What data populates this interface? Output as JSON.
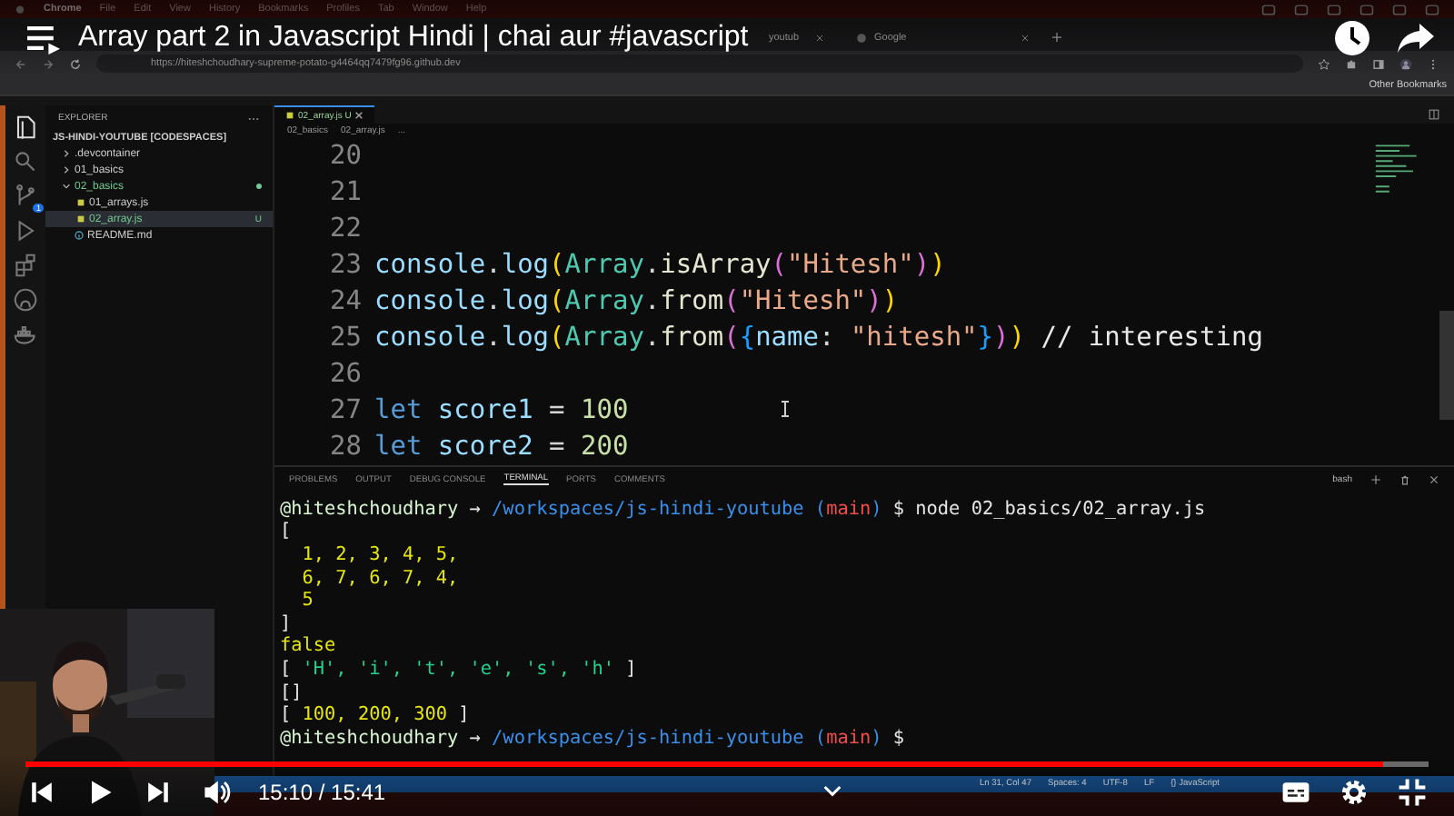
{
  "menu_bar": {
    "items": [
      "Chrome",
      "File",
      "Edit",
      "View",
      "History",
      "Bookmarks",
      "Profiles",
      "Tab",
      "Window",
      "Help"
    ]
  },
  "browser": {
    "tabs": [
      {
        "label": "youtub",
        "selected": false
      },
      {
        "label": "Google",
        "selected": false
      }
    ],
    "url": "https://hiteshchoudhary-supreme-potato-g4464qq7479fg96.github.dev",
    "bookmarks": [
      "Other Bookmarks"
    ]
  },
  "activity_bar": [
    {
      "selected": true
    },
    {
      "selected": false
    },
    {
      "selected": false,
      "badge": "1"
    },
    {
      "selected": false
    },
    {
      "selected": false
    },
    {
      "selected": false
    },
    {
      "selected": false
    }
  ],
  "explorer": {
    "title": "EXPLORER",
    "root": "JS-HINDI-YOUTUBE [CODESPACES]",
    "items": [
      {
        "label": ".devcontainer",
        "kind": "folder",
        "expanded": false,
        "selected": false,
        "untracked": false
      },
      {
        "label": "01_basics",
        "kind": "folder",
        "expanded": false,
        "selected": false,
        "untracked": false
      },
      {
        "label": "02_basics",
        "kind": "folder",
        "expanded": true,
        "selected": false,
        "untracked": true,
        "children": [
          {
            "label": "01_arrays.js",
            "kind": "js",
            "selected": false,
            "untracked": false
          },
          {
            "label": "02_array.js",
            "kind": "js",
            "selected": true,
            "untracked": true,
            "badge": "U"
          }
        ]
      },
      {
        "label": "README.md",
        "kind": "info",
        "selected": false,
        "untracked": false
      }
    ]
  },
  "editor": {
    "tabs": [
      {
        "label": "02_array.js",
        "badge": "U",
        "selected": true
      }
    ],
    "breadcrumb": [
      "02_basics",
      "02_array.js",
      "..."
    ],
    "lines": [
      {
        "number": "20"
      },
      {
        "number": "21"
      },
      {
        "number": "22"
      },
      {
        "number": "23",
        "tokens": [
          {
            "t": "console",
            "kind": "ident"
          },
          {
            "t": ".",
            "kind": "plain"
          },
          {
            "t": "log",
            "kind": "ident"
          },
          {
            "t": "(",
            "kind": "b1"
          },
          {
            "t": "Array",
            "kind": "type"
          },
          {
            "t": ".",
            "kind": "plain"
          },
          {
            "t": "isArray",
            "kind": "func"
          },
          {
            "t": "(",
            "kind": "b2"
          },
          {
            "t": "\"Hitesh\"",
            "kind": "str"
          },
          {
            "t": ")",
            "kind": "b2"
          },
          {
            "t": ")",
            "kind": "b1"
          }
        ]
      },
      {
        "number": "24",
        "tokens": [
          {
            "t": "console",
            "kind": "ident"
          },
          {
            "t": ".",
            "kind": "plain"
          },
          {
            "t": "log",
            "kind": "ident"
          },
          {
            "t": "(",
            "kind": "b1"
          },
          {
            "t": "Array",
            "kind": "type"
          },
          {
            "t": ".",
            "kind": "plain"
          },
          {
            "t": "from",
            "kind": "func"
          },
          {
            "t": "(",
            "kind": "b2"
          },
          {
            "t": "\"Hitesh\"",
            "kind": "str"
          },
          {
            "t": ")",
            "kind": "b2"
          },
          {
            "t": ")",
            "kind": "b1"
          }
        ]
      },
      {
        "number": "25",
        "tokens": [
          {
            "t": "console",
            "kind": "ident"
          },
          {
            "t": ".",
            "kind": "plain"
          },
          {
            "t": "log",
            "kind": "ident"
          },
          {
            "t": "(",
            "kind": "b1"
          },
          {
            "t": "Array",
            "kind": "type"
          },
          {
            "t": ".",
            "kind": "plain"
          },
          {
            "t": "from",
            "kind": "func"
          },
          {
            "t": "(",
            "kind": "b2"
          },
          {
            "t": "{",
            "kind": "b3"
          },
          {
            "t": "name",
            "kind": "ident"
          },
          {
            "t": ": ",
            "kind": "plain"
          },
          {
            "t": "\"hitesh\"",
            "kind": "str"
          },
          {
            "t": "}",
            "kind": "b3"
          },
          {
            "t": ")",
            "kind": "b2"
          },
          {
            "t": ")",
            "kind": "b1"
          },
          {
            "t": " // interesting",
            "kind": "comment"
          }
        ]
      },
      {
        "number": "26"
      },
      {
        "number": "27",
        "tokens": [
          {
            "t": "let",
            "kind": "kw"
          },
          {
            "t": " score1",
            "kind": "ident"
          },
          {
            "t": " = ",
            "kind": "plain"
          },
          {
            "t": "100",
            "kind": "num"
          }
        ]
      },
      {
        "number": "28",
        "tokens": [
          {
            "t": "let",
            "kind": "kw"
          },
          {
            "t": " score2",
            "kind": "ident"
          },
          {
            "t": " = ",
            "kind": "plain"
          },
          {
            "t": "200",
            "kind": "num"
          }
        ]
      }
    ]
  },
  "panel": {
    "tabs": [
      {
        "label": "PROBLEMS",
        "selected": false
      },
      {
        "label": "OUTPUT",
        "selected": false
      },
      {
        "label": "DEBUG CONSOLE",
        "selected": false
      },
      {
        "label": "TERMINAL",
        "selected": true
      },
      {
        "label": "PORTS",
        "selected": false
      },
      {
        "label": "COMMENTS",
        "selected": false
      }
    ],
    "shell": "bash",
    "terminal": [
      [
        {
          "t": "@hiteshchoudhary",
          "kind": "user"
        },
        {
          "t": " → ",
          "kind": "plain"
        },
        {
          "t": "/workspaces/js-hindi-youtube (",
          "kind": "path"
        },
        {
          "t": "main",
          "kind": "branch"
        },
        {
          "t": ")",
          "kind": "path"
        },
        {
          "t": " $ node 02_basics/02_array.js",
          "kind": "plain"
        }
      ],
      [
        {
          "t": "[",
          "kind": "plain"
        }
      ],
      [
        {
          "t": "  1, 2, 3, 4, 5,",
          "kind": "num"
        }
      ],
      [
        {
          "t": "  6, 7, 6, 7, 4,",
          "kind": "num"
        }
      ],
      [
        {
          "t": "  5",
          "kind": "num"
        }
      ],
      [
        {
          "t": "]",
          "kind": "plain"
        }
      ],
      [
        {
          "t": "false",
          "kind": "num"
        }
      ],
      [
        {
          "t": "[ ",
          "kind": "plain"
        },
        {
          "t": "'H', 'i', 't', 'e', 's', 'h'",
          "kind": "str"
        },
        {
          "t": " ]",
          "kind": "plain"
        }
      ],
      [
        {
          "t": "[]",
          "kind": "plain"
        }
      ],
      [
        {
          "t": "[ ",
          "kind": "plain"
        },
        {
          "t": "100, 200, 300",
          "kind": "num"
        },
        {
          "t": " ]",
          "kind": "plain"
        }
      ],
      [
        {
          "t": "@hiteshchoudhary",
          "kind": "user"
        },
        {
          "t": " → ",
          "kind": "plain"
        },
        {
          "t": "/workspaces/js-hindi-youtube (",
          "kind": "path"
        },
        {
          "t": "main",
          "kind": "branch"
        },
        {
          "t": ")",
          "kind": "path"
        },
        {
          "t": " $ ",
          "kind": "plain"
        }
      ]
    ]
  },
  "status_bar": [
    "Ln 31, Col 47",
    "Spaces: 4",
    "UTF-8",
    "LF",
    "{} JavaScript"
  ],
  "video": {
    "title": "Array part 2 in Javascript Hindi | chai aur #javascript",
    "time": "15:10 / 15:41",
    "progress": {
      "level": 0.967
    }
  }
}
